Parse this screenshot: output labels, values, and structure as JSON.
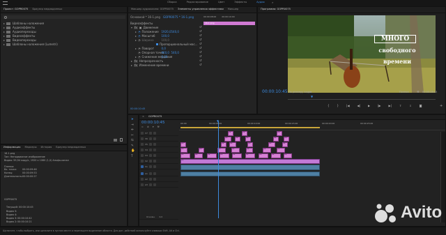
{
  "topbar": {
    "tabs": [
      "Сборка",
      "Редактирование",
      "Цвет",
      "Эффекты",
      "Аудио"
    ],
    "active": "Аудио",
    "menu_icon": "menu-lines-icon"
  },
  "project_panel": {
    "tabs": [
      "Проект: GOPR0075",
      "Браузер медиаданных"
    ],
    "folders": [
      "Шаблоны наложения",
      "Аудиоэффекты",
      "Аудиопереходы",
      "Видеоэффекты",
      "Видеопереходы",
      "Шаблоны наложения (Lumetri)"
    ]
  },
  "effect_controls": {
    "tabs": [
      "Микшер аудиоклипа: GOPR0075",
      "Элементы управления эффектами",
      "Микшер"
    ],
    "active_tab": "Элементы управления эффектами",
    "master_label": "Основной * 16-1.png",
    "sequence_label": "GOPR0075 * 16-1.png",
    "clip_badge": "16-1.png",
    "ruler_times": [
      "00:00:08:00",
      "00:00:10:00"
    ],
    "section": "Видеоэффекты",
    "motion": "Движение",
    "params": [
      {
        "name": "Положение",
        "v1": "1920,0",
        "v2": "540,0"
      },
      {
        "name": "Масштаб",
        "v1": "100,0"
      },
      {
        "name": "Ширина",
        "v1": "100,0"
      },
      {
        "name": "",
        "v1": "Пропорциональный мас..."
      },
      {
        "name": "Поворот",
        "v1": "0,0"
      },
      {
        "name": "Опорная точка",
        "v1": "960,0",
        "v2": "540,0"
      },
      {
        "name": "Снижение мерцания",
        "v1": "0,00"
      }
    ],
    "opacity": "Непрозрачность",
    "remap": "Изменение времени",
    "timecode": "00:00:10:45"
  },
  "program_monitor": {
    "title": "Программа: GOPR0075",
    "overlay_lines": [
      "МНОГО",
      "свободного",
      "времени"
    ],
    "timecode": "00:00:10:45",
    "fit": "По размеру кадра",
    "quality": "Полное",
    "duration": "00:00:28:43"
  },
  "info_panel": {
    "tabs": [
      "Информация",
      "Маркеры",
      "История",
      "Браузер медиаданных"
    ],
    "clip_name": "16-1.png",
    "type_line": "Тип: Неподвижное изображение",
    "video_line": "Видео: 59,94 кадр/с, 1920 x 1080 (1,0) Альфа-канал",
    "tape_header": "Пленка:",
    "entries": [
      {
        "k": "Вх. точка:",
        "v": "00:00:09:46"
      },
      {
        "k": "Конец:",
        "v": "00:00:09:53"
      },
      {
        "k": "Длительность:",
        "v": "00:00:00:27"
      }
    ],
    "seq_name": "GOPR0075",
    "current": "Текущий: 00:00:10:45",
    "video_tracks": [
      {
        "k": "Видео 5:",
        "v": ""
      },
      {
        "k": "Видео 4:",
        "v": ""
      },
      {
        "k": "Видео 3:",
        "v": "00:00:10:42"
      },
      {
        "k": "Видео 2:",
        "v": "00:00:10:21"
      }
    ]
  },
  "timeline": {
    "seq_tab": "GOPR0075",
    "timecode": "00:00:10:45",
    "ruler": [
      "00:00",
      "00:00:05:00",
      "00:00:10:00",
      "00:00:15:00",
      "00:00:20:00",
      "00:00:25:00"
    ],
    "video_tracks": [
      "V7",
      "V6",
      "V5",
      "V4",
      "V3",
      "V2",
      "V1"
    ],
    "audio_tracks": [
      "A1",
      "A2",
      "A3"
    ],
    "master": "Основн.",
    "master_value": "0,0",
    "clip_label": "16"
  },
  "statusbar": {
    "text": "Щелкните, чтобы выбрать, или щелкните в пустом месте и перетащите выделение области. Для доп. действий используйте клавиши Shift, Alt и Ctrl."
  },
  "watermark": "Avito",
  "colors": {
    "accent_blue": "#3d8be0",
    "video_clip": "#d681d4",
    "audio_clip": "#4e7fa3",
    "clip_badge": "#d07ad3"
  }
}
